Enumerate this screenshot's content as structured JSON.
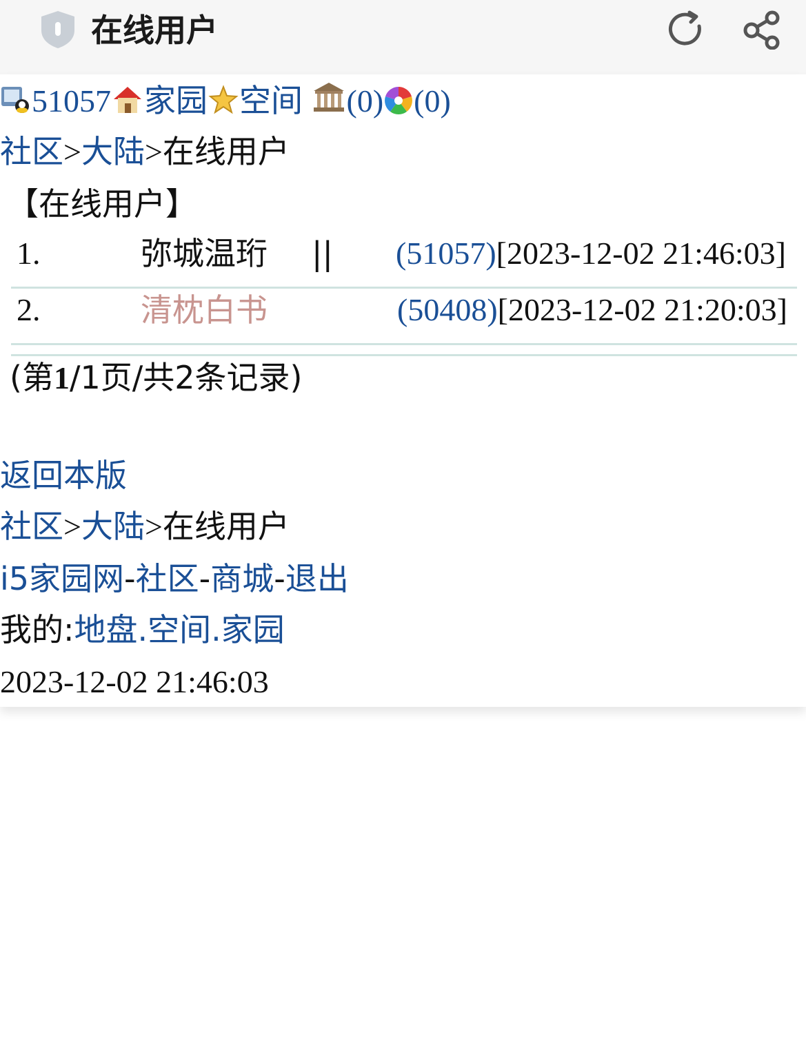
{
  "header": {
    "title": "在线用户"
  },
  "userbar": {
    "user_id": "51057",
    "home_label": "家园",
    "space_label": "空间",
    "bank_count": "(0)",
    "color_count": "(0)"
  },
  "breadcrumb": {
    "community": "社区",
    "sep": ">",
    "mainland": "大陆",
    "current": "在线用户"
  },
  "section_title": "【在线用户】",
  "users": [
    {
      "index": "1.",
      "name": "弥城温珩",
      "sep": "||",
      "id": "(51057)",
      "time": "[2023-12-02 21:46:03]"
    },
    {
      "index": "2.",
      "name": "清枕白书",
      "sep": "",
      "id": "(50408)",
      "time": "[2023-12-02 21:20:03]"
    }
  ],
  "pager": {
    "prefix": "(第",
    "current": "1",
    "rest": "/1页/共2条记录)"
  },
  "back_link": "返回本版",
  "footer_breadcrumb": {
    "community": "社区",
    "sep": ">",
    "mainland": "大陆",
    "current": "在线用户"
  },
  "footer_nav": {
    "site": "i5家园网",
    "dash": "-",
    "community": "社区",
    "mall": "商城",
    "logout": "退出"
  },
  "my": {
    "label": "我的:",
    "land": "地盘",
    "dot": ".",
    "space": "空间",
    "home": "家园"
  },
  "timestamp": "2023-12-02 21:46:03",
  "colors": {
    "link": "#1a4f96",
    "gray_name": "#c8948f",
    "rule": "#cfe3e0"
  }
}
